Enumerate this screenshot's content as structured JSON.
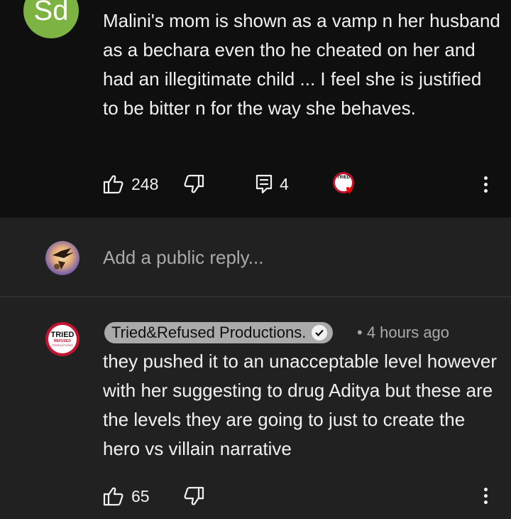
{
  "parent_comment": {
    "avatar_initials": "Sd",
    "text": "Malini's mom is shown as a vamp n her husband as a bechara even tho he cheated on her and had an illegitimate child ... I feel she is justified to be bitter n for the way she behaves.",
    "likes": "248",
    "replies": "4",
    "creator_heart_badge": "TRIED"
  },
  "reply_box": {
    "placeholder": "Add a public reply..."
  },
  "reply": {
    "author": "Tried&Refused Productions.",
    "separator": "•",
    "timestamp": "4 hours ago",
    "text": "they pushed it to an unacceptable level however with her suggesting to drug Aditya but these are the levels they are going to just to create the hero vs villain narrative",
    "likes": "65",
    "avatar_logo": {
      "line1": "TRIED",
      "line2": "REFUSED",
      "line3": "PRODUCTIONS"
    }
  },
  "colors": {
    "background": "#212121",
    "top_panel": "#0f0f0f",
    "avatar_sd": "#7cb342",
    "brand_red": "#c4122f",
    "heart": "#ff0000"
  },
  "icons": [
    "thumbs-up-icon",
    "thumbs-down-icon",
    "comment-icon",
    "kebab-menu-icon",
    "verified-check-icon",
    "heart-icon"
  ]
}
